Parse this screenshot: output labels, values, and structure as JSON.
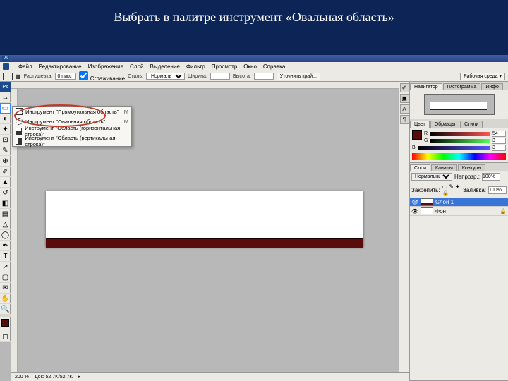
{
  "slide": {
    "title": "Выбрать в палитре инструмент «Овальная область»"
  },
  "menu": {
    "file": "Файл",
    "edit": "Редактирование",
    "image": "Изображение",
    "layer": "Слой",
    "select": "Выделение",
    "filter": "Фильтр",
    "view": "Просмотр",
    "window": "Окно",
    "help": "Справка"
  },
  "options": {
    "feather_label": "Растушевка:",
    "feather_value": "0 пикс",
    "antialias": "Сглаживание",
    "style_label": "Стиль:",
    "style_value": "Нормальный",
    "width_label": "Ширина:",
    "height_label": "Высота:",
    "refine": "Уточнить край...",
    "workspace": "Рабочая среда ▾"
  },
  "flyout": {
    "rect": "Инструмент \"Прямоугольная область\"",
    "oval": "Инструмент \"Овальная область\"",
    "row": "Инструмент \"Область (горизонтальная строка)\"",
    "col": "Инструмент \"Область (вертикальная строка)\"",
    "key": "M"
  },
  "panels": {
    "nav": {
      "navigator": "Навигатор",
      "histogram": "Гистограмма",
      "info": "Инфо"
    },
    "color": {
      "color": "Цвет",
      "swatches": "Образцы",
      "styles": "Стили",
      "r": "R",
      "g": "G",
      "b": "B",
      "rv": "54",
      "gv": "3",
      "bv": "3"
    },
    "layers": {
      "layers": "Слои",
      "channels": "Каналы",
      "paths": "Контуры",
      "mode": "Нормальный",
      "opacity_label": "Непрозр.:",
      "opacity": "100%",
      "lock_label": "Закрепить:",
      "fill_label": "Заливка:",
      "fill": "100%",
      "layer1": "Слой 1",
      "bg": "Фон"
    }
  },
  "status": {
    "zoom": "200 %",
    "docinfo": "Док: 52,7K/52,7K"
  }
}
